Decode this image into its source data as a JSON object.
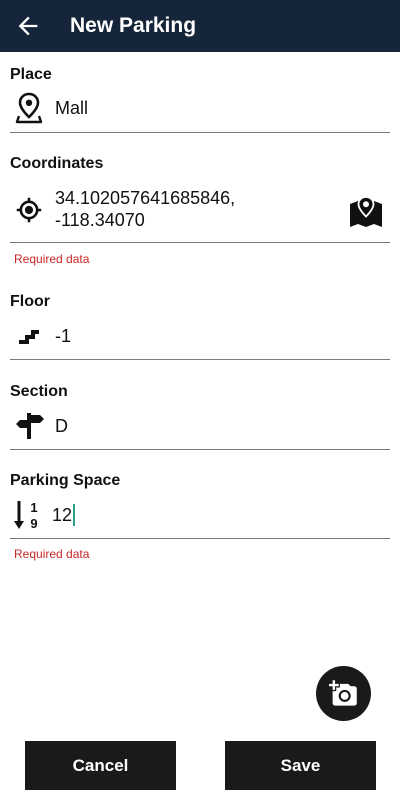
{
  "appbar": {
    "title": "New Parking",
    "back_icon": "arrow-back-icon",
    "background": "#16263a"
  },
  "fields": {
    "place": {
      "label": "Place",
      "value": "Mall",
      "icon": "location-pin-icon"
    },
    "coordinates": {
      "label": "Coordinates",
      "value_line1": "34.102057641685846,",
      "value_line2": "-118.34070",
      "icon": "gps-target-icon",
      "action_icon": "map-icon",
      "error": "Required data"
    },
    "floor": {
      "label": "Floor",
      "value": "-1",
      "icon": "stairs-icon"
    },
    "section": {
      "label": "Section",
      "value": "D",
      "icon": "signpost-icon"
    },
    "parking_space": {
      "label": "Parking Space",
      "value": "12",
      "icon": "sort-numeric-icon",
      "icon_top": "1",
      "icon_bottom": "9",
      "error": "Required data"
    }
  },
  "fab": {
    "icon": "add-photo-icon"
  },
  "buttons": {
    "cancel": "Cancel",
    "save": "Save"
  },
  "colors": {
    "error": "#c62828",
    "caret": "#2a9d8f",
    "button_bg": "#1a1a1d"
  }
}
